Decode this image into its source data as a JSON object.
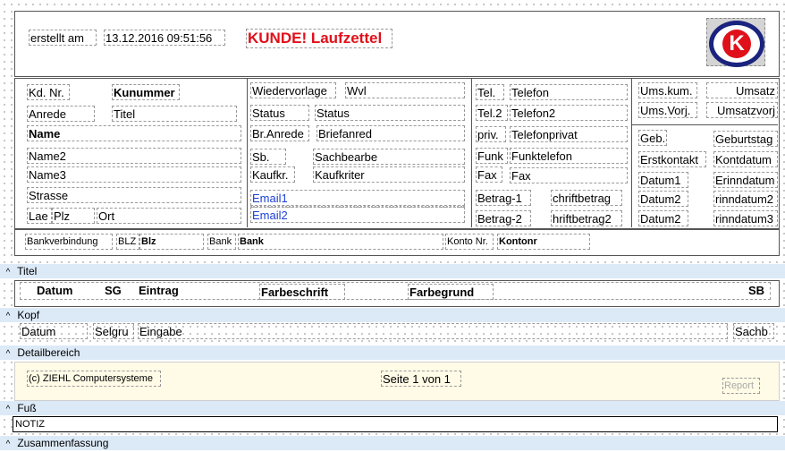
{
  "header": {
    "erstellt_label": "erstellt am",
    "date": "13.12.2016 09:51:56",
    "title": "KUNDE! Laufzettel",
    "logo_letter": "K"
  },
  "customer": {
    "kd_nr_label": "Kd. Nr.",
    "kd_nr_value": "Kunummer",
    "anrede_label": "Anrede",
    "titel": "Titel",
    "name": "Name",
    "name2": "Name2",
    "name3": "Name3",
    "strasse": "Strasse",
    "lae": "Lae",
    "plz": "Plz",
    "ort": "Ort"
  },
  "middle": {
    "wiedervorlage_label": "Wiedervorlage",
    "wvl": "Wvl",
    "status_label": "Status",
    "status_value": "Status",
    "bri_label": "Br.Anrede",
    "briefanred": "Briefanred",
    "sb_label": "Sb.",
    "sachbearbe": "Sachbearbe",
    "kaufkr_label": "Kaufkr.",
    "kaufkriter": "Kaufkriter",
    "email1": "Email1",
    "email2": "Email2"
  },
  "contact": {
    "tel_label": "Tel.",
    "telefon": "Telefon",
    "tel2_label": "Tel.2",
    "telefon2": "Telefon2",
    "priv_label": "priv.",
    "telefonprivat": "Telefonprivat",
    "funk_label": "Funk",
    "funktelefon": "Funktelefon",
    "fax_label": "Fax",
    "fax_value": "Fax",
    "betrag1_label": "Betrag-1",
    "betrag1_value": "chriftbetrag",
    "betrag2_label": "Betrag-2",
    "betrag2_value": "hriftbetrag2"
  },
  "right": {
    "umskum_label": "Ums.kum.",
    "umskum_value": "Umsatz",
    "umsvorj_label": "Ums.Vorj.",
    "umsvorj_value": "Umsatzvorj",
    "geb_label": "Geb.",
    "geb_value": "Geburtstag",
    "erstkontakt_label": "Erstkontakt",
    "erstkontakt_value": "Kontdatum",
    "datum1_label": "Datum1",
    "datum1_value": "Erinndatum",
    "datum2a_label": "Datum2",
    "datum2a_value": "rinndatum2",
    "datum2b_label": "Datum2",
    "datum2b_value": "rinndatum3"
  },
  "bank": {
    "bankverbindung_label": "Bankverbindung",
    "blz_label": "BLZ",
    "blz_value": "Blz",
    "bank_label": "Bank",
    "bank_value": "Bank",
    "konto_label": "Konto Nr.",
    "konto_value": "Kontonr"
  },
  "bands": {
    "titel": "Titel",
    "kopf": "Kopf",
    "detail": "Detailbereich",
    "fuss": "Fuß",
    "zusammenfassung": "Zusammenfassung"
  },
  "kopf_columns": {
    "datum": "Datum",
    "sg": "SG",
    "eintrag": "Eintrag",
    "farbeschrift": "Farbeschrift",
    "farbegrund": "Farbegrund",
    "sb": "SB"
  },
  "detail_fields": {
    "datum": "Datum",
    "selgru": "Selgru",
    "eingabe": "Eingabe",
    "sachb": "Sachb"
  },
  "footer": {
    "copyright": "(c) ZIEHL Computersysteme",
    "seite": "Seite 1 von 1",
    "report": "Report"
  },
  "summary": {
    "notiz": "NOTIZ"
  },
  "colors": {
    "band": "#dce9f7",
    "title_red": "#e0101a",
    "logo_blue": "#1a237e",
    "email_blue": "#1b3fd6",
    "footer_bg": "#fffbe6"
  }
}
